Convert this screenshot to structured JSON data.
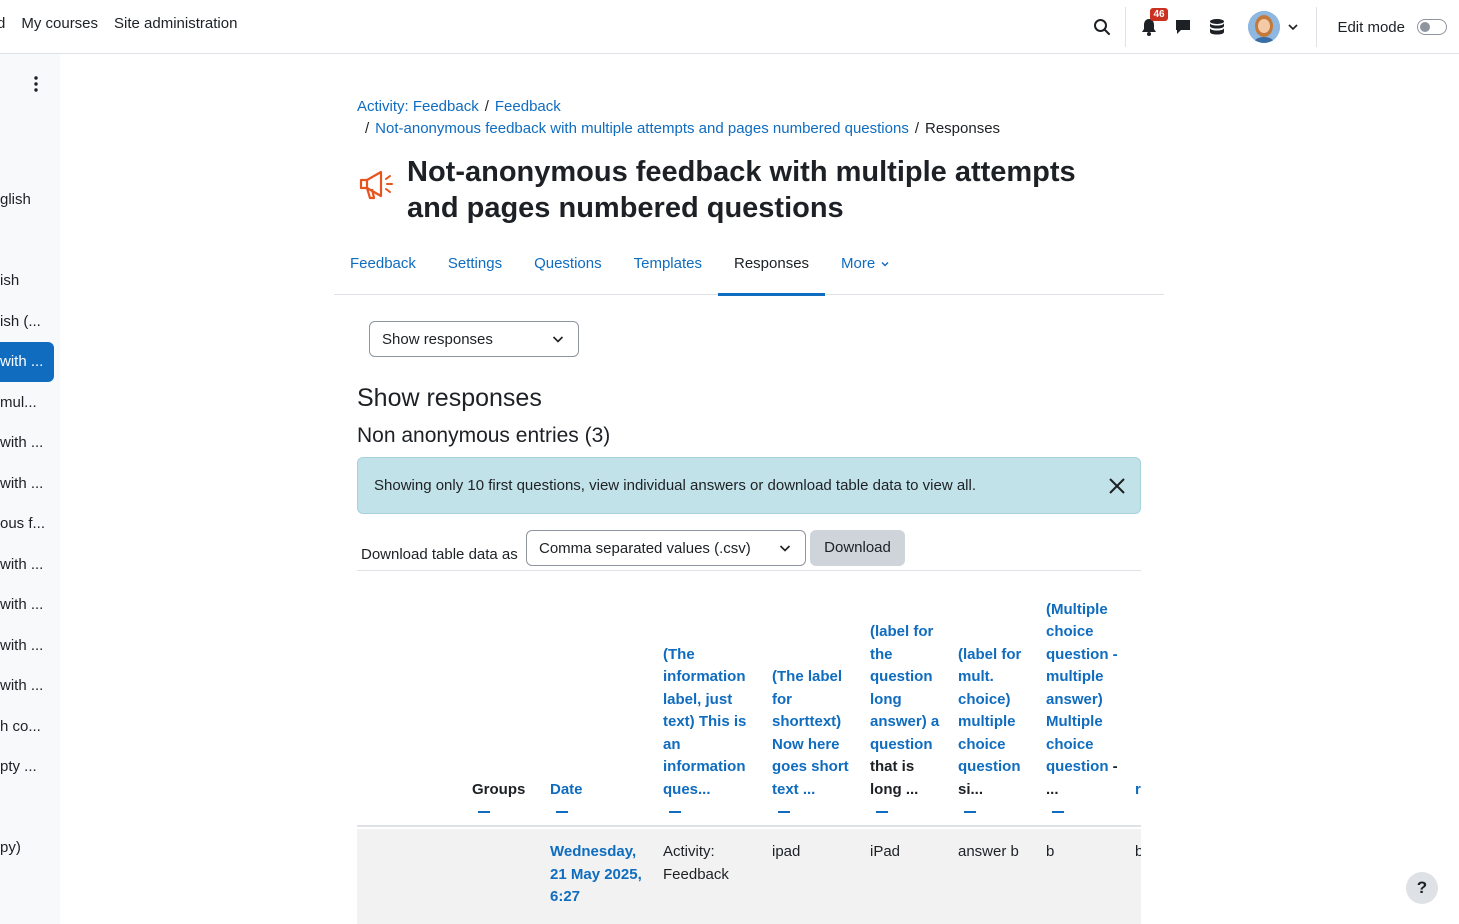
{
  "nav": {
    "items": [
      "d",
      "My courses",
      "Site administration"
    ],
    "notification_count": "46",
    "edit_mode_label": "Edit mode"
  },
  "drawer": {
    "items": [
      "glish",
      "ish",
      "ish (...",
      "with ...",
      " mul...",
      "with ...",
      "with ...",
      "ous f...",
      "with ...",
      "with ...",
      "with ...",
      "with ...",
      "h co...",
      "pty ...",
      "py)"
    ],
    "active_index": 3
  },
  "breadcrumb": {
    "items": [
      "Activity: Feedback",
      "Feedback",
      "Not-anonymous feedback with multiple attempts and pages numbered questions"
    ],
    "current": "Responses"
  },
  "page_title": "Not-anonymous feedback with multiple attempts and pages numbered questions",
  "tabs": [
    "Feedback",
    "Settings",
    "Questions",
    "Templates",
    "Responses",
    "More"
  ],
  "active_tab": "Responses",
  "view_select": {
    "value": "Show responses"
  },
  "heading": "Show responses",
  "subheading": "Non anonymous entries (3)",
  "alert": {
    "text": "Showing only 10 first questions, view individual answers or download table data to view all."
  },
  "download": {
    "label": "Download table data as",
    "format": "Comma separated values (.csv)",
    "button": "Download"
  },
  "table": {
    "headers": [
      {
        "link": "",
        "plain": "Groups"
      },
      {
        "link": "Date",
        "plain": ""
      },
      {
        "link": "(The information label, just text) This is an information ques...",
        "plain": ""
      },
      {
        "link": "(The label for shorttext) Now here goes short text ...",
        "plain": ""
      },
      {
        "link": "(label for the question long answer) a question",
        "plain": "that is long ..."
      },
      {
        "link": "(label for mult. choice) multiple choice question",
        "plain": "si..."
      },
      {
        "link": "(Multiple choice question - multiple answer) Multiple choice question",
        "plain": "- ..."
      },
      {
        "link": "r c s",
        "plain": "."
      }
    ],
    "row": {
      "date": "Wednesday, 21 May 2025, 6:27",
      "cells": [
        "Activity: Feedback",
        "ipad",
        "iPad",
        "answer b",
        "b",
        "b"
      ]
    }
  },
  "help_label": "?"
}
